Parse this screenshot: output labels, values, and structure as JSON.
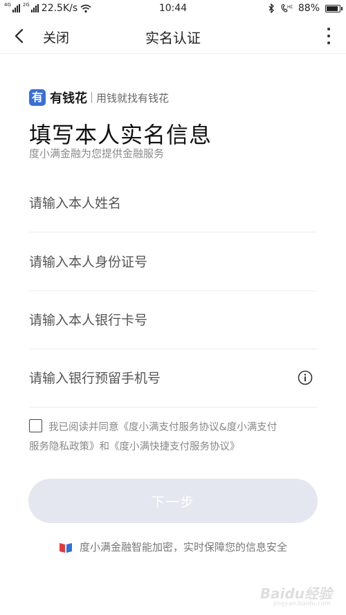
{
  "status_bar": {
    "network_tag_1": "4G",
    "network_tag_2": "2G",
    "speed": "22.5K/s",
    "time": "10:44",
    "battery": "88%",
    "battery_level": 0.88
  },
  "nav": {
    "back_icon": "chevron-left-icon",
    "close_label": "关闭",
    "title": "实名认证",
    "more_icon": "more-vertical-icon"
  },
  "brand": {
    "logo_char": "有",
    "name": "有钱花",
    "slogan": "用钱就找有钱花",
    "color": "#3a6fd8"
  },
  "header": {
    "title": "填写本人实名信息",
    "subtitle": "度小满金融为您提供金融服务"
  },
  "form": {
    "name_placeholder": "请输入本人姓名",
    "id_placeholder": "请输入本人身份证号",
    "card_placeholder": "请输入本人银行卡号",
    "phone_placeholder": "请输入银行预留手机号",
    "phone_info_icon": "info-icon"
  },
  "agreement": {
    "checked": false,
    "line1": "我已阅读并同意《度小满支付服务协议&度小满支付",
    "line2": "服务隐私政策》和《度小满快捷支付服务协议》"
  },
  "actions": {
    "next_label": "下一步",
    "next_bg": "#e4e7ef"
  },
  "footer": {
    "security_icon": "security-shield-icon",
    "security_text": "度小满金融智能加密，实时保障您的信息安全"
  },
  "watermark": {
    "text": "Baidu经验",
    "sub": "jingyan.baidu.com"
  }
}
